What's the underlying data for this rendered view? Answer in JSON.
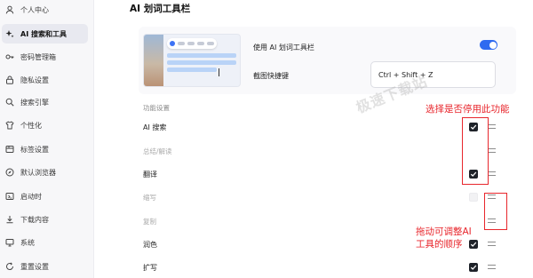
{
  "sidebar": {
    "items": [
      {
        "label": "个人中心",
        "icon": "user-icon",
        "active": false
      },
      {
        "label": "AI 搜索和工具",
        "icon": "sparkle-icon",
        "active": true
      },
      {
        "label": "密码管理箱",
        "icon": "key-icon",
        "active": false
      },
      {
        "label": "隐私设置",
        "icon": "lock-icon",
        "active": false
      },
      {
        "label": "搜索引擎",
        "icon": "search-icon",
        "active": false
      },
      {
        "label": "个性化",
        "icon": "shirt-icon",
        "active": false
      },
      {
        "label": "标签设置",
        "icon": "tab-icon",
        "active": false
      },
      {
        "label": "默认浏览器",
        "icon": "compass-icon",
        "active": false
      },
      {
        "label": "启动时",
        "icon": "power-icon",
        "active": false
      },
      {
        "label": "下载内容",
        "icon": "download-icon",
        "active": false
      },
      {
        "label": "系统",
        "icon": "monitor-icon",
        "active": false
      },
      {
        "label": "重置设置",
        "icon": "reset-icon",
        "active": false
      }
    ]
  },
  "main": {
    "title": "AI 划词工具栏",
    "enable_label": "使用 AI 划词工具栏",
    "enable_on": true,
    "hotkey_label": "截图快捷键",
    "hotkey_value": "Ctrl + Shift + Z",
    "section_label": "功能设置",
    "features": [
      {
        "name": "AI 搜索",
        "checked": true,
        "enabled": true
      },
      {
        "name": "总结/解读",
        "checked": false,
        "enabled": false
      },
      {
        "name": "翻译",
        "checked": true,
        "enabled": true
      },
      {
        "name": "缩写",
        "checked": false,
        "enabled": false
      },
      {
        "name": "复制",
        "checked": false,
        "enabled": false
      },
      {
        "name": "润色",
        "checked": true,
        "enabled": true
      },
      {
        "name": "扩写",
        "checked": true,
        "enabled": true
      }
    ]
  },
  "watermark": "极速下载站",
  "annotations": {
    "top": "选择是否停用此功能",
    "bottom_line1": "拖动可调整AI",
    "bottom_line2": "工具的顺序"
  },
  "colors": {
    "accent": "#2f6bf0",
    "annotation": "#e8262c",
    "checkbox": "#1e2229"
  }
}
